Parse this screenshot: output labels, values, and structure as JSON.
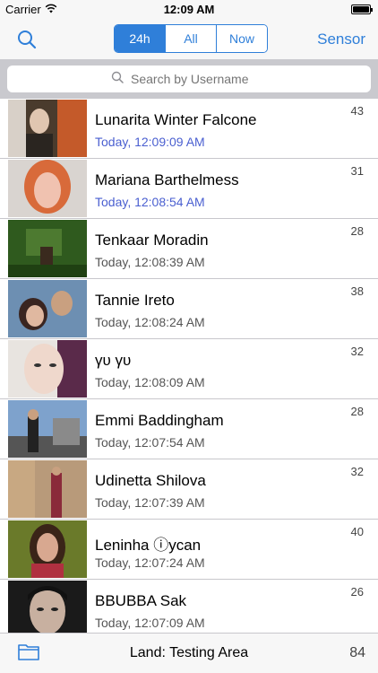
{
  "status_bar": {
    "carrier": "Carrier",
    "time": "12:09 AM"
  },
  "nav": {
    "segments": [
      "24h",
      "All",
      "Now"
    ],
    "active_segment": "24h",
    "sensor_label": "Sensor"
  },
  "search": {
    "placeholder": "Search by Username"
  },
  "rows": [
    {
      "name": "Lunarita Winter Falcone",
      "time": "Today, 12:09:09 AM",
      "distance": "43",
      "highlight": true
    },
    {
      "name": "Mariana Barthelmess",
      "time": "Today, 12:08:54 AM",
      "distance": "31",
      "highlight": true
    },
    {
      "name": "Tenkaar Moradin",
      "time": "Today, 12:08:39 AM",
      "distance": "28",
      "highlight": false
    },
    {
      "name": "Tannie Ireto",
      "time": "Today, 12:08:24 AM",
      "distance": "38",
      "highlight": false
    },
    {
      "name": "γυ γυ",
      "time": "Today, 12:08:09 AM",
      "distance": "32",
      "highlight": false
    },
    {
      "name": "Emmi Baddingham",
      "time": "Today, 12:07:54 AM",
      "distance": "28",
      "highlight": false
    },
    {
      "name": "Udinetta Shilova",
      "time": "Today, 12:07:39 AM",
      "distance": "32",
      "highlight": false
    },
    {
      "name": "Leninha ⓘycan",
      "time": "Today, 12:07:24 AM",
      "distance": "40",
      "highlight": false
    },
    {
      "name": "BBUBBA Sak",
      "time": "Today, 12:07:09 AM",
      "distance": "26",
      "highlight": false
    }
  ],
  "toolbar": {
    "land_label": "Land: Testing Area",
    "count": "84"
  },
  "colors": {
    "accent": "#2f7fd9",
    "time_highlight": "#4a5fd0"
  }
}
